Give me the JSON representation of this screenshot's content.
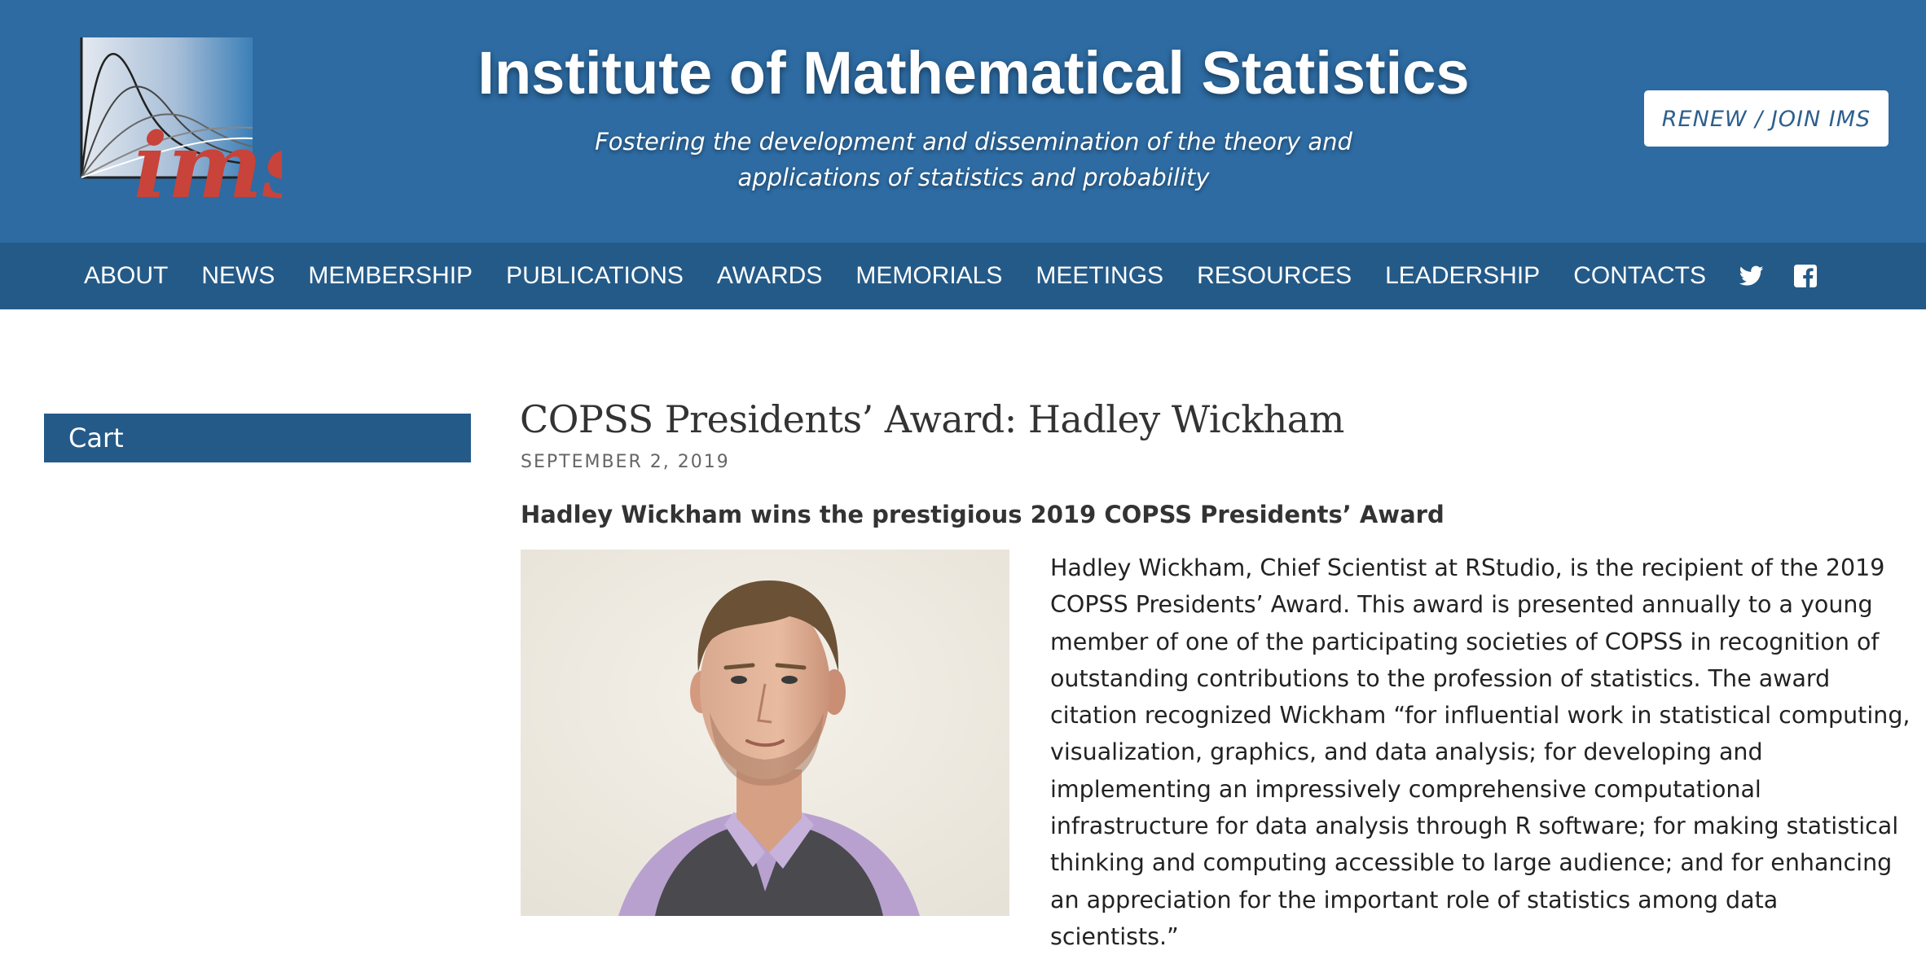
{
  "header": {
    "title": "Institute of Mathematical Statistics",
    "tagline_line1": "Fostering the development and dissemination of the theory and",
    "tagline_line2": "applications of statistics and probability",
    "renew_button": "RENEW / JOIN IMS",
    "logo_text": "ims",
    "logo_icon": "ims-logo",
    "colors": {
      "header_bg": "#2d6ba2",
      "nav_bg": "#245a88",
      "logo_red": "#c8433a"
    }
  },
  "nav": {
    "items": [
      {
        "label": "ABOUT"
      },
      {
        "label": "NEWS"
      },
      {
        "label": "MEMBERSHIP"
      },
      {
        "label": "PUBLICATIONS"
      },
      {
        "label": "AWARDS"
      },
      {
        "label": "MEMORIALS"
      },
      {
        "label": "MEETINGS"
      },
      {
        "label": "RESOURCES"
      },
      {
        "label": "LEADERSHIP"
      },
      {
        "label": "CONTACTS"
      }
    ],
    "social": [
      {
        "icon": "twitter-icon"
      },
      {
        "icon": "facebook-icon"
      }
    ]
  },
  "sidebar": {
    "cart_label": "Cart"
  },
  "post": {
    "title": "COPSS Presidents’ Award: Hadley Wickham",
    "date": "SEPTEMBER 2, 2019",
    "subhead": "Hadley Wickham wins the prestigious 2019 COPSS Presidents’ Award",
    "photo_icon": "portrait-photo",
    "body": "Hadley Wickham, Chief Scientist at RStudio, is the recipient of the 2019 COPSS Presidents’ Award. This award is presented annually to a young member of one of the participating societies of COPSS in recognition of outstanding contributions to the profession of statistics. The award citation recognized Wickham “for influential work in statistical computing, visualization, graphics, and data analysis; for developing and implementing an impressively comprehensive computational infrastructure for data analysis through R software; for making statistical thinking and computing accessible to large audience; and for enhancing an appreciation for the important role of statistics among data scientists.”"
  }
}
